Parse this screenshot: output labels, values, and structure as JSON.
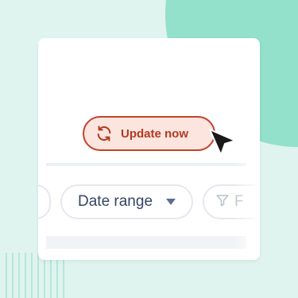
{
  "update_button": {
    "label": "Update now",
    "icon": "refresh-icon"
  },
  "filters": {
    "date_range_label": "Date range",
    "filter_label": "F"
  },
  "colors": {
    "background": "#dff4ee",
    "blob": "#93e0cb",
    "accent": "#c0432a",
    "button_fill": "#fbe5de"
  }
}
